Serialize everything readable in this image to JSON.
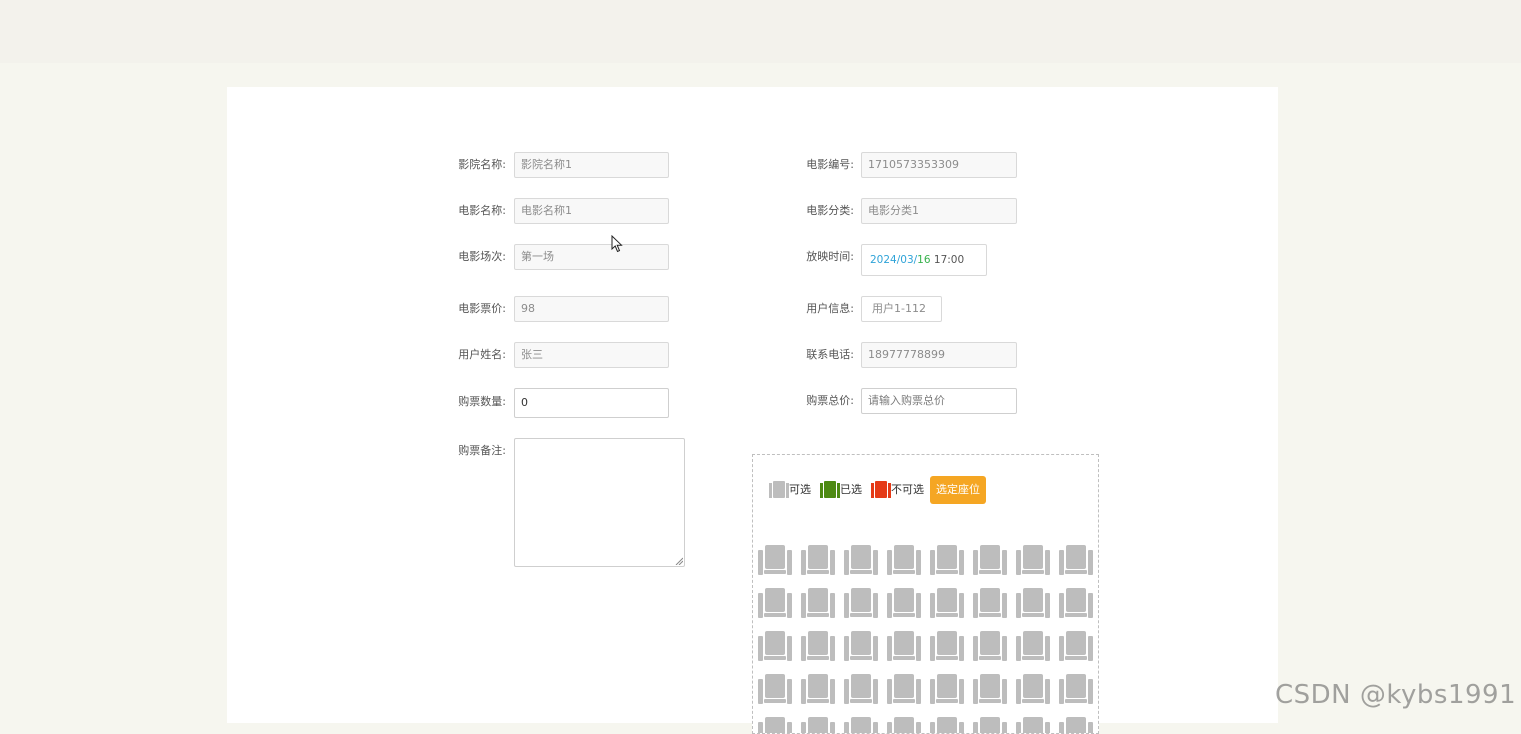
{
  "form": {
    "left": [
      {
        "key": "cinema_name",
        "label": "影院名称:",
        "placeholder": "影院名称1",
        "readonly": true
      },
      {
        "key": "movie_name",
        "label": "电影名称:",
        "placeholder": "电影名称1",
        "readonly": true
      },
      {
        "key": "screening",
        "label": "电影场次:",
        "placeholder": "第一场",
        "readonly": true
      },
      {
        "key": "ticket_price",
        "label": "电影票价:",
        "placeholder": "98",
        "readonly": true
      },
      {
        "key": "user_name",
        "label": "用户姓名:",
        "placeholder": "张三",
        "readonly": true
      },
      {
        "key": "ticket_quantity",
        "label": "购票数量:",
        "value": "0",
        "readonly": false
      },
      {
        "key": "remark",
        "label": "购票备注:",
        "value": "",
        "readonly": false
      }
    ],
    "right": [
      {
        "key": "movie_id",
        "label": "电影编号:",
        "placeholder": "1710573353309",
        "readonly": true
      },
      {
        "key": "movie_category",
        "label": "电影分类:",
        "placeholder": "电影分类1",
        "readonly": true
      },
      {
        "key": "show_time",
        "label": "放映时间:",
        "date_part1": "2024/03/",
        "date_part2": "16",
        "time": " 17:00",
        "readonly": true
      },
      {
        "key": "user_info",
        "label": "用户信息:",
        "placeholder": "用户1-112",
        "readonly": true
      },
      {
        "key": "phone",
        "label": "联系电话:",
        "placeholder": "18977778899",
        "readonly": true
      },
      {
        "key": "total_price",
        "label": "购票总价:",
        "placeholder": "请输入购票总价",
        "readonly": false
      }
    ]
  },
  "seat_legend": {
    "available": {
      "label": "可选",
      "color": "#bdbdbd"
    },
    "selected": {
      "label": "已选",
      "color": "#4e8a12"
    },
    "unavailable": {
      "label": "不可选",
      "color": "#e53a17"
    },
    "select_button": "选定座位",
    "button_color": "#f5a623"
  },
  "seats": {
    "rows": 5,
    "cols": 8,
    "status": "available"
  },
  "watermark": "CSDN @kybs1991"
}
